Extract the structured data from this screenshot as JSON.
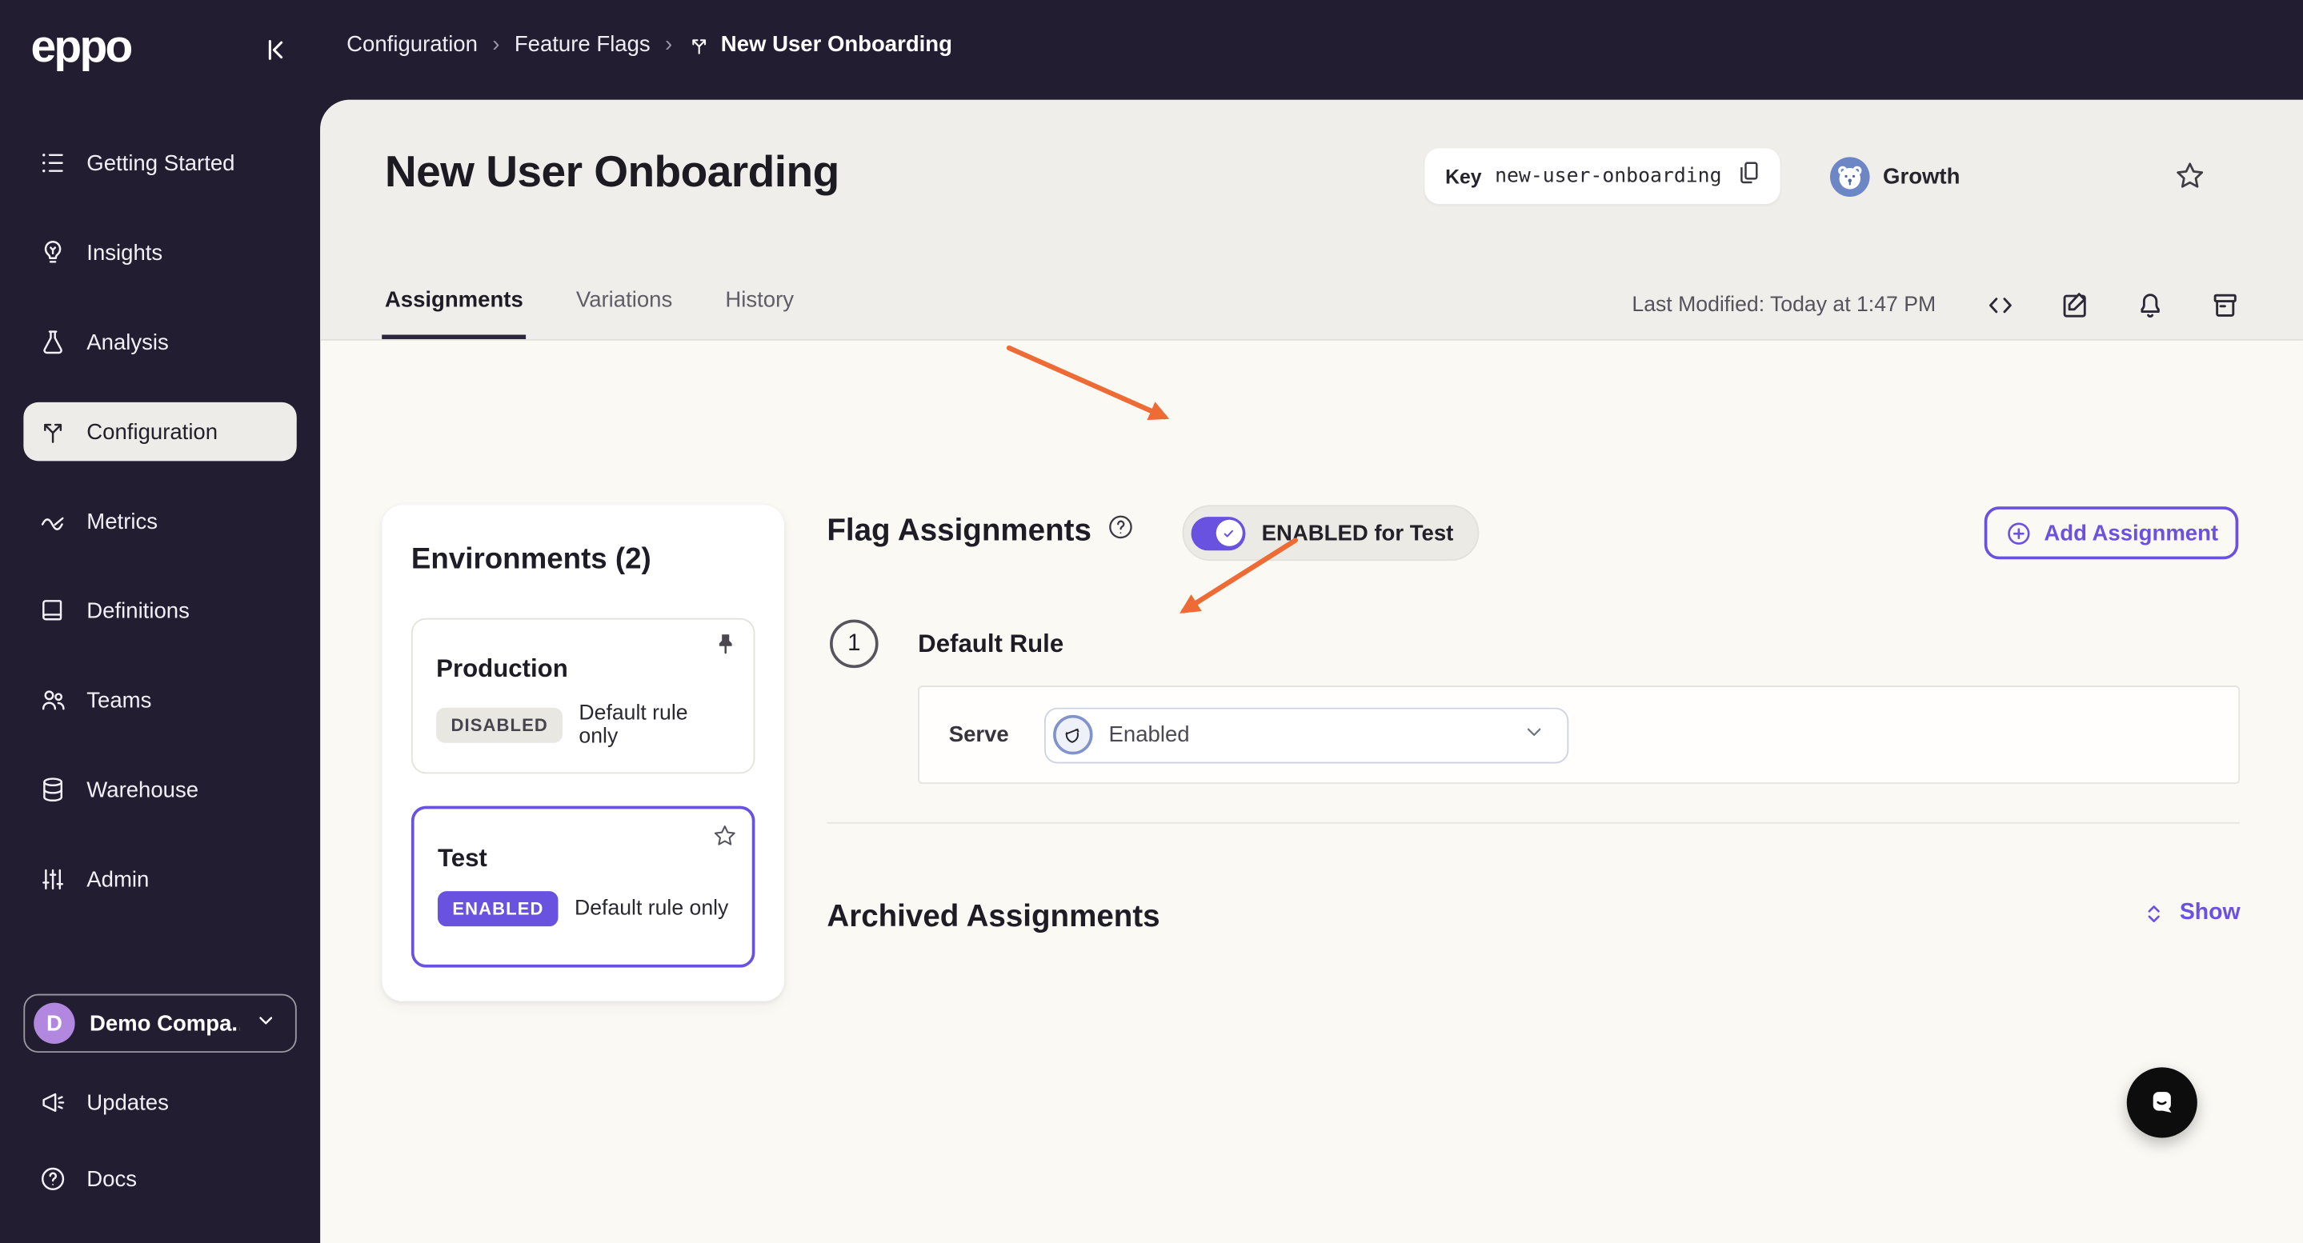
{
  "topbar": {
    "logo": "eppo",
    "breadcrumb": {
      "items": [
        "Configuration",
        "Feature Flags",
        "New User Onboarding"
      ],
      "separator": "›"
    }
  },
  "sidebar": {
    "items": [
      {
        "label": "Getting Started",
        "icon": "list-icon",
        "active": false
      },
      {
        "label": "Insights",
        "icon": "lightbulb-icon",
        "active": false
      },
      {
        "label": "Analysis",
        "icon": "flask-icon",
        "active": false
      },
      {
        "label": "Configuration",
        "icon": "split-arrows-icon",
        "active": true
      },
      {
        "label": "Metrics",
        "icon": "trend-icon",
        "active": false
      },
      {
        "label": "Definitions",
        "icon": "book-icon",
        "active": false
      },
      {
        "label": "Teams",
        "icon": "people-icon",
        "active": false
      },
      {
        "label": "Warehouse",
        "icon": "database-icon",
        "active": false
      },
      {
        "label": "Admin",
        "icon": "sliders-icon",
        "active": false
      }
    ],
    "company": {
      "label": "Demo Compa...",
      "avatar_letter": "D",
      "icon": "chevron-down-icon"
    },
    "footer_items": [
      {
        "label": "Updates",
        "icon": "megaphone-icon"
      },
      {
        "label": "Docs",
        "icon": "help-circle-icon"
      }
    ]
  },
  "header": {
    "title": "New User Onboarding",
    "key_label": "Key",
    "key_value": "new-user-onboarding",
    "key_copy_icon": "copy-icon",
    "team": {
      "name": "Growth",
      "avatar": "bear-icon"
    },
    "favorite_icon": "star-icon",
    "tabs": [
      {
        "label": "Assignments",
        "active": true
      },
      {
        "label": "Variations",
        "active": false
      },
      {
        "label": "History",
        "active": false
      }
    ],
    "last_modified": "Last Modified: Today at 1:47 PM",
    "action_icons": [
      "code-icon",
      "edit-icon",
      "bell-icon",
      "archive-icon"
    ]
  },
  "main": {
    "flag_assignments": {
      "title": "Flag Assignments",
      "help_icon": "help-circle-icon",
      "toggle_label": "ENABLED for Test",
      "toggle_on": true,
      "add_button_label": "Add Assignment"
    },
    "environments": {
      "title": "Environments (2)",
      "cards": [
        {
          "name": "Production",
          "status": "DISABLED",
          "description": "Default rule only",
          "corner_icon": "pin-icon"
        },
        {
          "name": "Test",
          "status": "ENABLED",
          "description": "Default rule only",
          "corner_icon": "star-icon",
          "selected": true
        }
      ]
    },
    "default_rule": {
      "step_number": "1",
      "title": "Default Rule",
      "serve_label": "Serve",
      "serve_value": "Enabled",
      "serve_icon": "variation-acorn-icon"
    },
    "archived": {
      "title": "Archived Assignments",
      "action_label": "Show",
      "action_icon": "chevrons-up-down-icon"
    }
  },
  "annotations": {
    "arrow_count": 2,
    "arrow_color": "#ee6b35"
  },
  "chat_widget": {
    "icon": "chat-bubble-icon"
  },
  "colors": {
    "accent_purple": "#6a52e0",
    "topbar_bg": "#231d31",
    "header_bg": "#efeeea",
    "content_bg": "#faf9f4",
    "card_bg": "#ffffff",
    "arrow_orange": "#ee6b35",
    "team_avatar_bg": "#6d87c6",
    "company_avatar_bg": "#b287e0",
    "disabled_badge_bg": "#e9e7e2"
  }
}
